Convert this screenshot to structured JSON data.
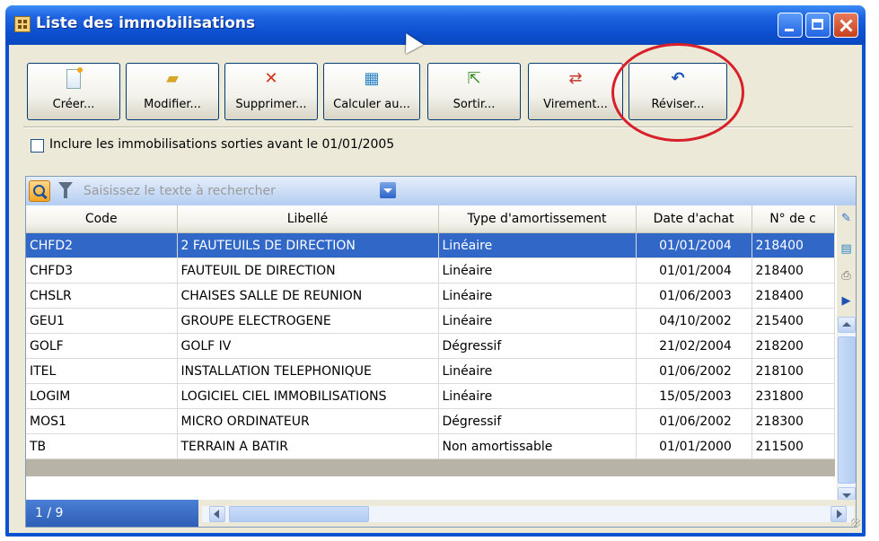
{
  "window": {
    "title": "Liste des immobilisations"
  },
  "toolbar": {
    "buttons": [
      {
        "label": "Créer...",
        "icon": "new-document-icon"
      },
      {
        "label": "Modifier...",
        "icon": "open-folder-icon"
      },
      {
        "label": "Supprimer...",
        "icon": "delete-icon"
      },
      {
        "label": "Calculer au...",
        "icon": "calculator-icon"
      },
      {
        "label": "Sortir...",
        "icon": "exit-icon"
      },
      {
        "label": "Virement...",
        "icon": "transfer-icon"
      },
      {
        "label": "Réviser...",
        "icon": "revise-icon"
      }
    ]
  },
  "options": {
    "include_checkbox_label": "Inclure les immobilisations sorties avant le 01/01/2005",
    "include_checked": false
  },
  "search": {
    "placeholder": "Saisissez le texte à rechercher"
  },
  "table": {
    "columns": [
      "Code",
      "Libellé",
      "Type d'amortissement",
      "Date d'achat",
      "N° de c"
    ],
    "rows": [
      {
        "code": "CHFD2",
        "libelle": "2 FAUTEUILS DE DIRECTION",
        "type": "Linéaire",
        "date": "01/01/2004",
        "num": "218400"
      },
      {
        "code": "CHFD3",
        "libelle": "FAUTEUIL DE DIRECTION",
        "type": "Linéaire",
        "date": "01/01/2004",
        "num": "218400"
      },
      {
        "code": "CHSLR",
        "libelle": "CHAISES SALLE DE REUNION",
        "type": "Linéaire",
        "date": "01/06/2003",
        "num": "218400"
      },
      {
        "code": "GEU1",
        "libelle": "GROUPE ELECTROGENE",
        "type": "Linéaire",
        "date": "04/10/2002",
        "num": "215400"
      },
      {
        "code": "GOLF",
        "libelle": "GOLF IV",
        "type": "Dégressif",
        "date": "21/02/2004",
        "num": "218200"
      },
      {
        "code": "ITEL",
        "libelle": "INSTALLATION TELEPHONIQUE",
        "type": "Linéaire",
        "date": "01/06/2002",
        "num": "218100"
      },
      {
        "code": "LOGIM",
        "libelle": "LOGICIEL CIEL IMMOBILISATIONS",
        "type": "Linéaire",
        "date": "15/05/2003",
        "num": "231800"
      },
      {
        "code": "MOS1",
        "libelle": "MICRO ORDINATEUR",
        "type": "Dégressif",
        "date": "01/06/2002",
        "num": "218300"
      },
      {
        "code": "TB",
        "libelle": "TERRAIN A BATIR",
        "type": "Non amortissable",
        "date": "01/01/2000",
        "num": "211500"
      }
    ],
    "selected_row": 0
  },
  "footer": {
    "page_counter": "1 / 9"
  },
  "colors": {
    "titlebar": "#0c4fcf",
    "selection": "#3168c8",
    "highlight_circle": "#d7202a",
    "client_bg": "#ece9d8"
  }
}
